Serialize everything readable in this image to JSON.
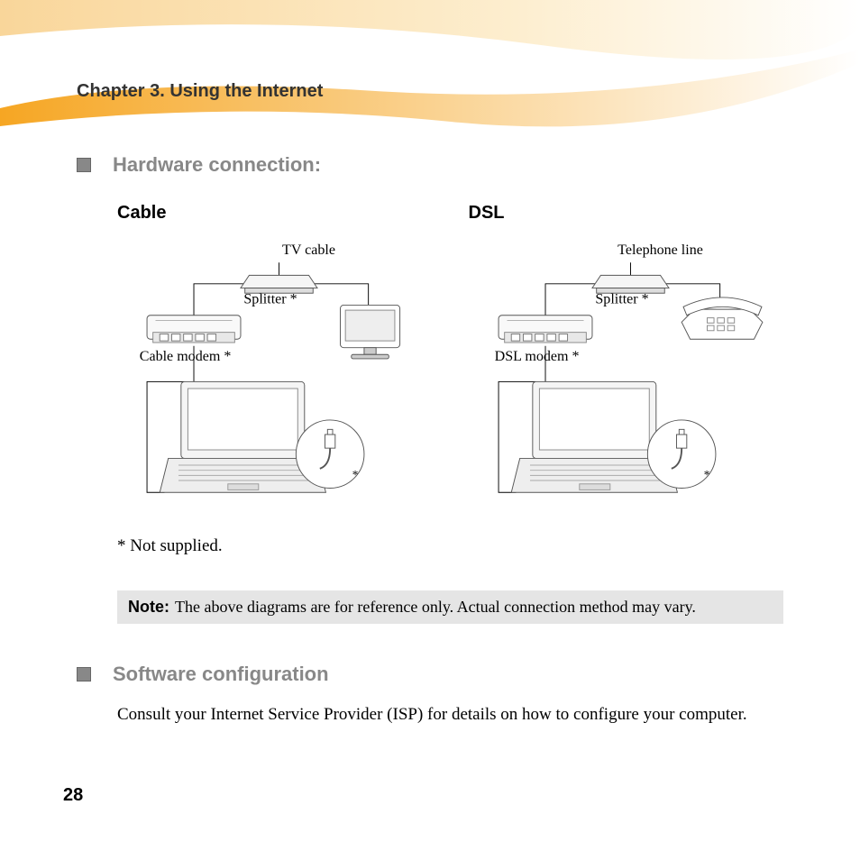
{
  "chapter_title": "Chapter 3. Using the Internet",
  "section1": {
    "heading": "Hardware connection:"
  },
  "diagrams": {
    "cable": {
      "title": "Cable",
      "source_label": "TV cable",
      "splitter_label": "Splitter *",
      "modem_label": "Cable modem *"
    },
    "dsl": {
      "title": "DSL",
      "source_label": "Telephone line",
      "splitter_label": "Splitter *",
      "modem_label": "DSL modem *"
    }
  },
  "footnote": "* Not supplied.",
  "note": {
    "label": "Note:",
    "text": "The above diagrams are for reference only. Actual connection method may vary."
  },
  "section2": {
    "heading": "Software configuration",
    "body": "Consult your Internet Service Provider (ISP) for details on how to configure your computer."
  },
  "page_number": "28"
}
